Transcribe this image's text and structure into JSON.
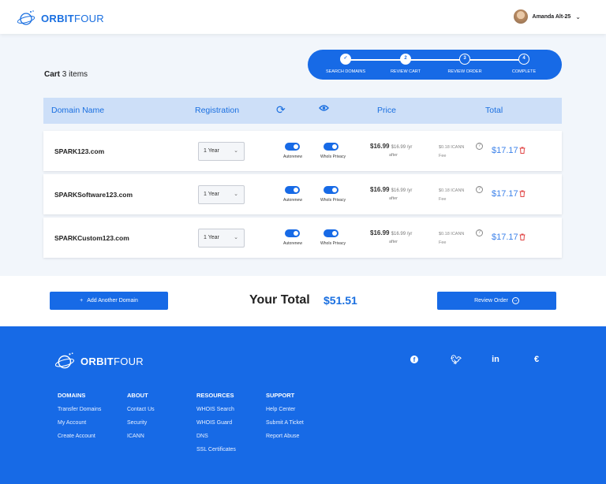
{
  "brand": {
    "bold": "ORBIT",
    "light": "FOUR"
  },
  "user": {
    "name": "Amanda Alt-25"
  },
  "cart": {
    "title": "Cart",
    "count": "3 items"
  },
  "steps": [
    {
      "label": "SEARCH DOMAINS",
      "mark": "✓"
    },
    {
      "label": "REVIEW CART",
      "mark": "2"
    },
    {
      "label": "REVIEW ORDER",
      "mark": "3"
    },
    {
      "label": "COMPLETE",
      "mark": "4"
    }
  ],
  "table": {
    "headers": {
      "domain": "Domain Name",
      "registration": "Registration",
      "price": "Price",
      "total": "Total"
    },
    "rows": [
      {
        "domain": "SPARK123.com",
        "term": "1 Year",
        "autorenew": "Autorenew",
        "privacy": "WhoIs Privacy",
        "price": "$16.99",
        "renew": "$16.99 /yr",
        "after": "after",
        "icann": "$0.18 ICANN",
        "fee": "Fee",
        "total": "$17.17"
      },
      {
        "domain": "SPARKSoftware123.com",
        "term": "1 Year",
        "autorenew": "Autorenew",
        "privacy": "WhoIs Privacy",
        "price": "$16.99",
        "renew": "$16.99 /yr",
        "after": "after",
        "icann": "$0.18 ICANN",
        "fee": "Fee",
        "total": "$17.17"
      },
      {
        "domain": "SPARKCustom123.com",
        "term": "1 Year",
        "autorenew": "Autorenew",
        "privacy": "WhoIs Privacy",
        "price": "$16.99",
        "renew": "$16.99 /yr",
        "after": "after",
        "icann": "$0.18 ICANN",
        "fee": "Fee",
        "total": "$17.17"
      }
    ]
  },
  "summary": {
    "add": "Add Another Domain",
    "your_total": "Your Total",
    "total": "$51.51",
    "review": "Review Order"
  },
  "footer": {
    "columns": [
      {
        "title": "DOMAINS",
        "links": [
          "Transfer Domains",
          "My Account",
          "Create Account"
        ]
      },
      {
        "title": "ABOUT",
        "links": [
          "Contact Us",
          "Security",
          "ICANN"
        ]
      },
      {
        "title": "RESOURCES",
        "links": [
          "WHOIS Search",
          "WHOIS Guard",
          "DNS",
          "SSL Certificates"
        ]
      },
      {
        "title": "SUPPORT",
        "links": [
          "Help Center",
          "Submit A Ticket",
          "Report Abuse"
        ]
      }
    ]
  },
  "colors": {
    "primary": "#176ae6",
    "header_bg": "#cddff8",
    "danger": "#e04444"
  }
}
